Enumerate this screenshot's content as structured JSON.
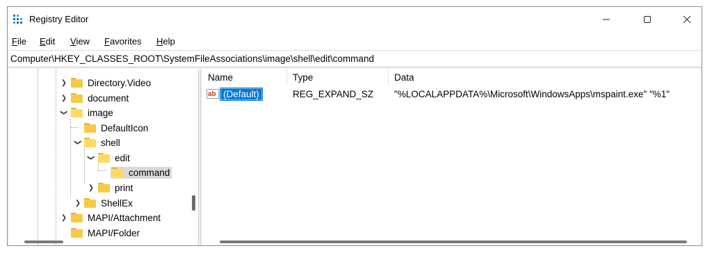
{
  "window": {
    "title": "Registry Editor",
    "controls": {
      "minimize": "minimize",
      "maximize": "maximize",
      "close": "close"
    }
  },
  "menu": {
    "items": [
      {
        "first": "F",
        "rest": "ile"
      },
      {
        "first": "E",
        "rest": "dit"
      },
      {
        "first": "V",
        "rest": "iew"
      },
      {
        "first": "F",
        "rest": "avorites"
      },
      {
        "first": "H",
        "rest": "elp"
      }
    ]
  },
  "address": {
    "path": "Computer\\HKEY_CLASSES_ROOT\\SystemFileAssociations\\image\\shell\\edit\\command"
  },
  "tree": {
    "items": [
      {
        "label": "Directory.Video",
        "expander": "collapsed",
        "depth": 0
      },
      {
        "label": "document",
        "expander": "collapsed",
        "depth": 0
      },
      {
        "label": "image",
        "expander": "expanded",
        "depth": 0
      },
      {
        "label": "DefaultIcon",
        "expander": "none",
        "depth": 1
      },
      {
        "label": "shell",
        "expander": "expanded",
        "depth": 1
      },
      {
        "label": "edit",
        "expander": "expanded",
        "depth": 2
      },
      {
        "label": "command",
        "expander": "none",
        "depth": 3,
        "selected": true
      },
      {
        "label": "print",
        "expander": "collapsed",
        "depth": 2
      },
      {
        "label": "ShellEx",
        "expander": "collapsed",
        "depth": 1
      },
      {
        "label": "MAPI/Attachment",
        "expander": "collapsed",
        "depth": 0
      },
      {
        "label": "MAPI/Folder",
        "expander": "none",
        "depth": 0
      }
    ]
  },
  "list": {
    "columns": {
      "name": "Name",
      "type": "Type",
      "data": "Data"
    },
    "rows": [
      {
        "name": "(Default)",
        "type": "REG_EXPAND_SZ",
        "data": "\"%LOCALAPPDATA%\\Microsoft\\WindowsApps\\mspaint.exe\" \"%1\"",
        "icon": "string-value-icon",
        "selected": true
      }
    ]
  },
  "colors": {
    "selection": "#0078d4",
    "folder": "#f7c948",
    "app_icon": "#0a6fc2"
  }
}
